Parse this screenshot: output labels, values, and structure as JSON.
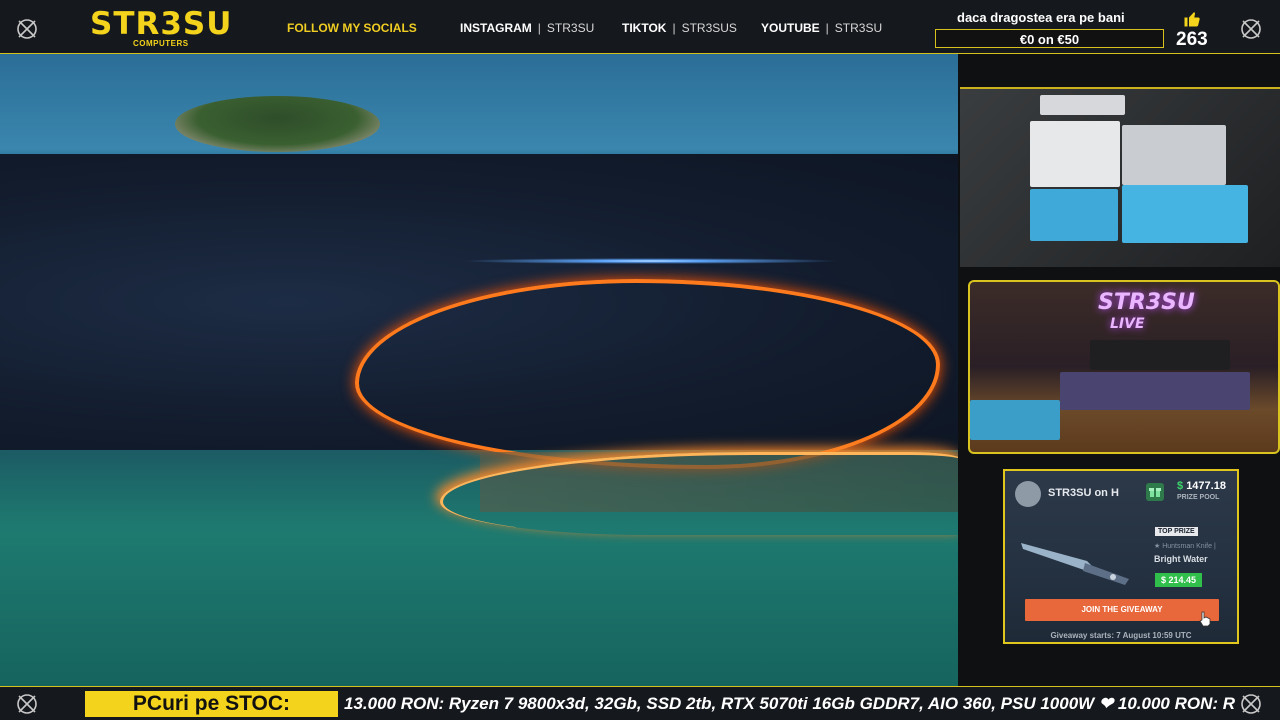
{
  "header": {
    "logo_main": "STR3SU",
    "logo_sub": "COMPUTERS",
    "follow_label": "FOLLOW MY SOCIALS",
    "socials": [
      {
        "name": "INSTAGRAM",
        "handle": "STR3SU"
      },
      {
        "name": "TIKTOK",
        "handle": "STR3SUS"
      },
      {
        "name": "YOUTUBE",
        "handle": "STR3SU"
      }
    ],
    "goal_title": "daca dragostea era pe bani",
    "goal_progress": "€0 on €50",
    "goal_current": 0,
    "goal_target": 50,
    "like_count": "263",
    "accent_color": "#f3d31b"
  },
  "webcams": {
    "neon_sign": "STR3SU",
    "neon_sub": "LIVE"
  },
  "giveaway": {
    "title": "STR3SU on H",
    "prize_pool": "1477.18",
    "prize_pool_label": "PRIZE POOL",
    "top_prize_label": "TOP PRIZE",
    "prize_subtitle": "★ Huntsman Knife |",
    "prize_name": "Bright Water",
    "prize_price": "$ 214.45",
    "join_button": "JOIN THE GIVEAWAY",
    "starts_text": "Giveaway starts: 7 August 10:59 UTC"
  },
  "ticker": {
    "label": "PCuri pe STOC:",
    "text": "13.000 RON: Ryzen 7 9800x3d, 32Gb, SSD 2tb, RTX 5070ti 16Gb GDDR7, AIO 360, PSU 1000W ❤ 10.000 RON: R"
  },
  "icons": {
    "corner": "crosshair-icon",
    "like": "thumbs-up-icon",
    "gift": "gift-icon",
    "cursor": "hand-cursor-icon"
  }
}
